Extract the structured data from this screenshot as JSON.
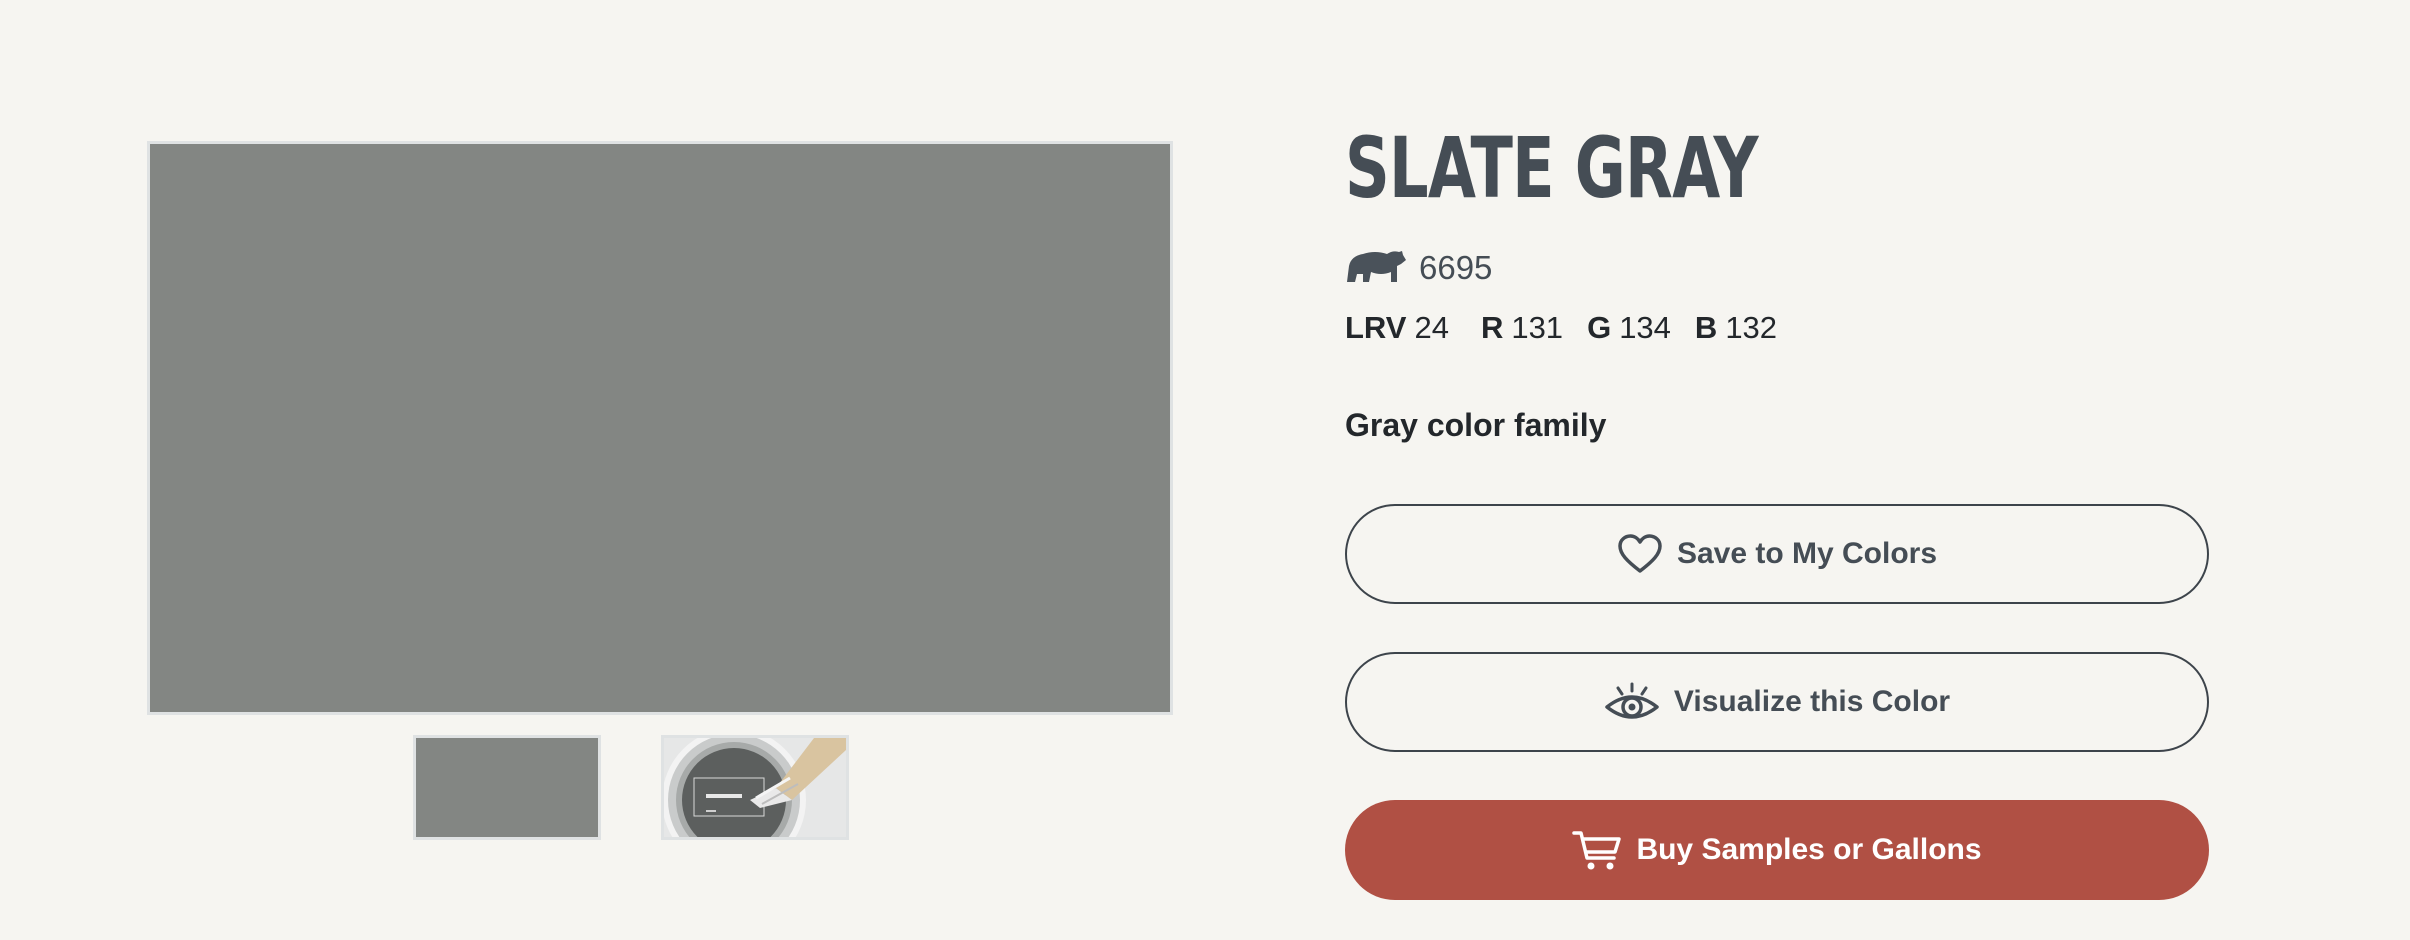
{
  "color": {
    "name": "SLATE GRAY",
    "code": "6695",
    "swatch_hex": "#838683",
    "family": "Gray color family"
  },
  "values": {
    "lrv_label": "LRV",
    "lrv": "24",
    "r_label": "R",
    "r": "131",
    "g_label": "G",
    "g": "134",
    "b_label": "B",
    "b": "132"
  },
  "thumbnails": [
    {
      "icon": "color-swatch"
    },
    {
      "icon": "paint-can-with-brush"
    }
  ],
  "buttons": {
    "save_label": "Save to My Colors",
    "save_icon": "heart-icon",
    "visualize_label": "Visualize this Color",
    "visualize_icon": "eye-icon",
    "buy_label": "Buy Samples or Gallons",
    "buy_icon": "cart-icon"
  },
  "theme": {
    "background": "#f6f5f1",
    "text_dark": "#454d55",
    "accent": "#b05044",
    "logo_icon": "bear-icon"
  }
}
